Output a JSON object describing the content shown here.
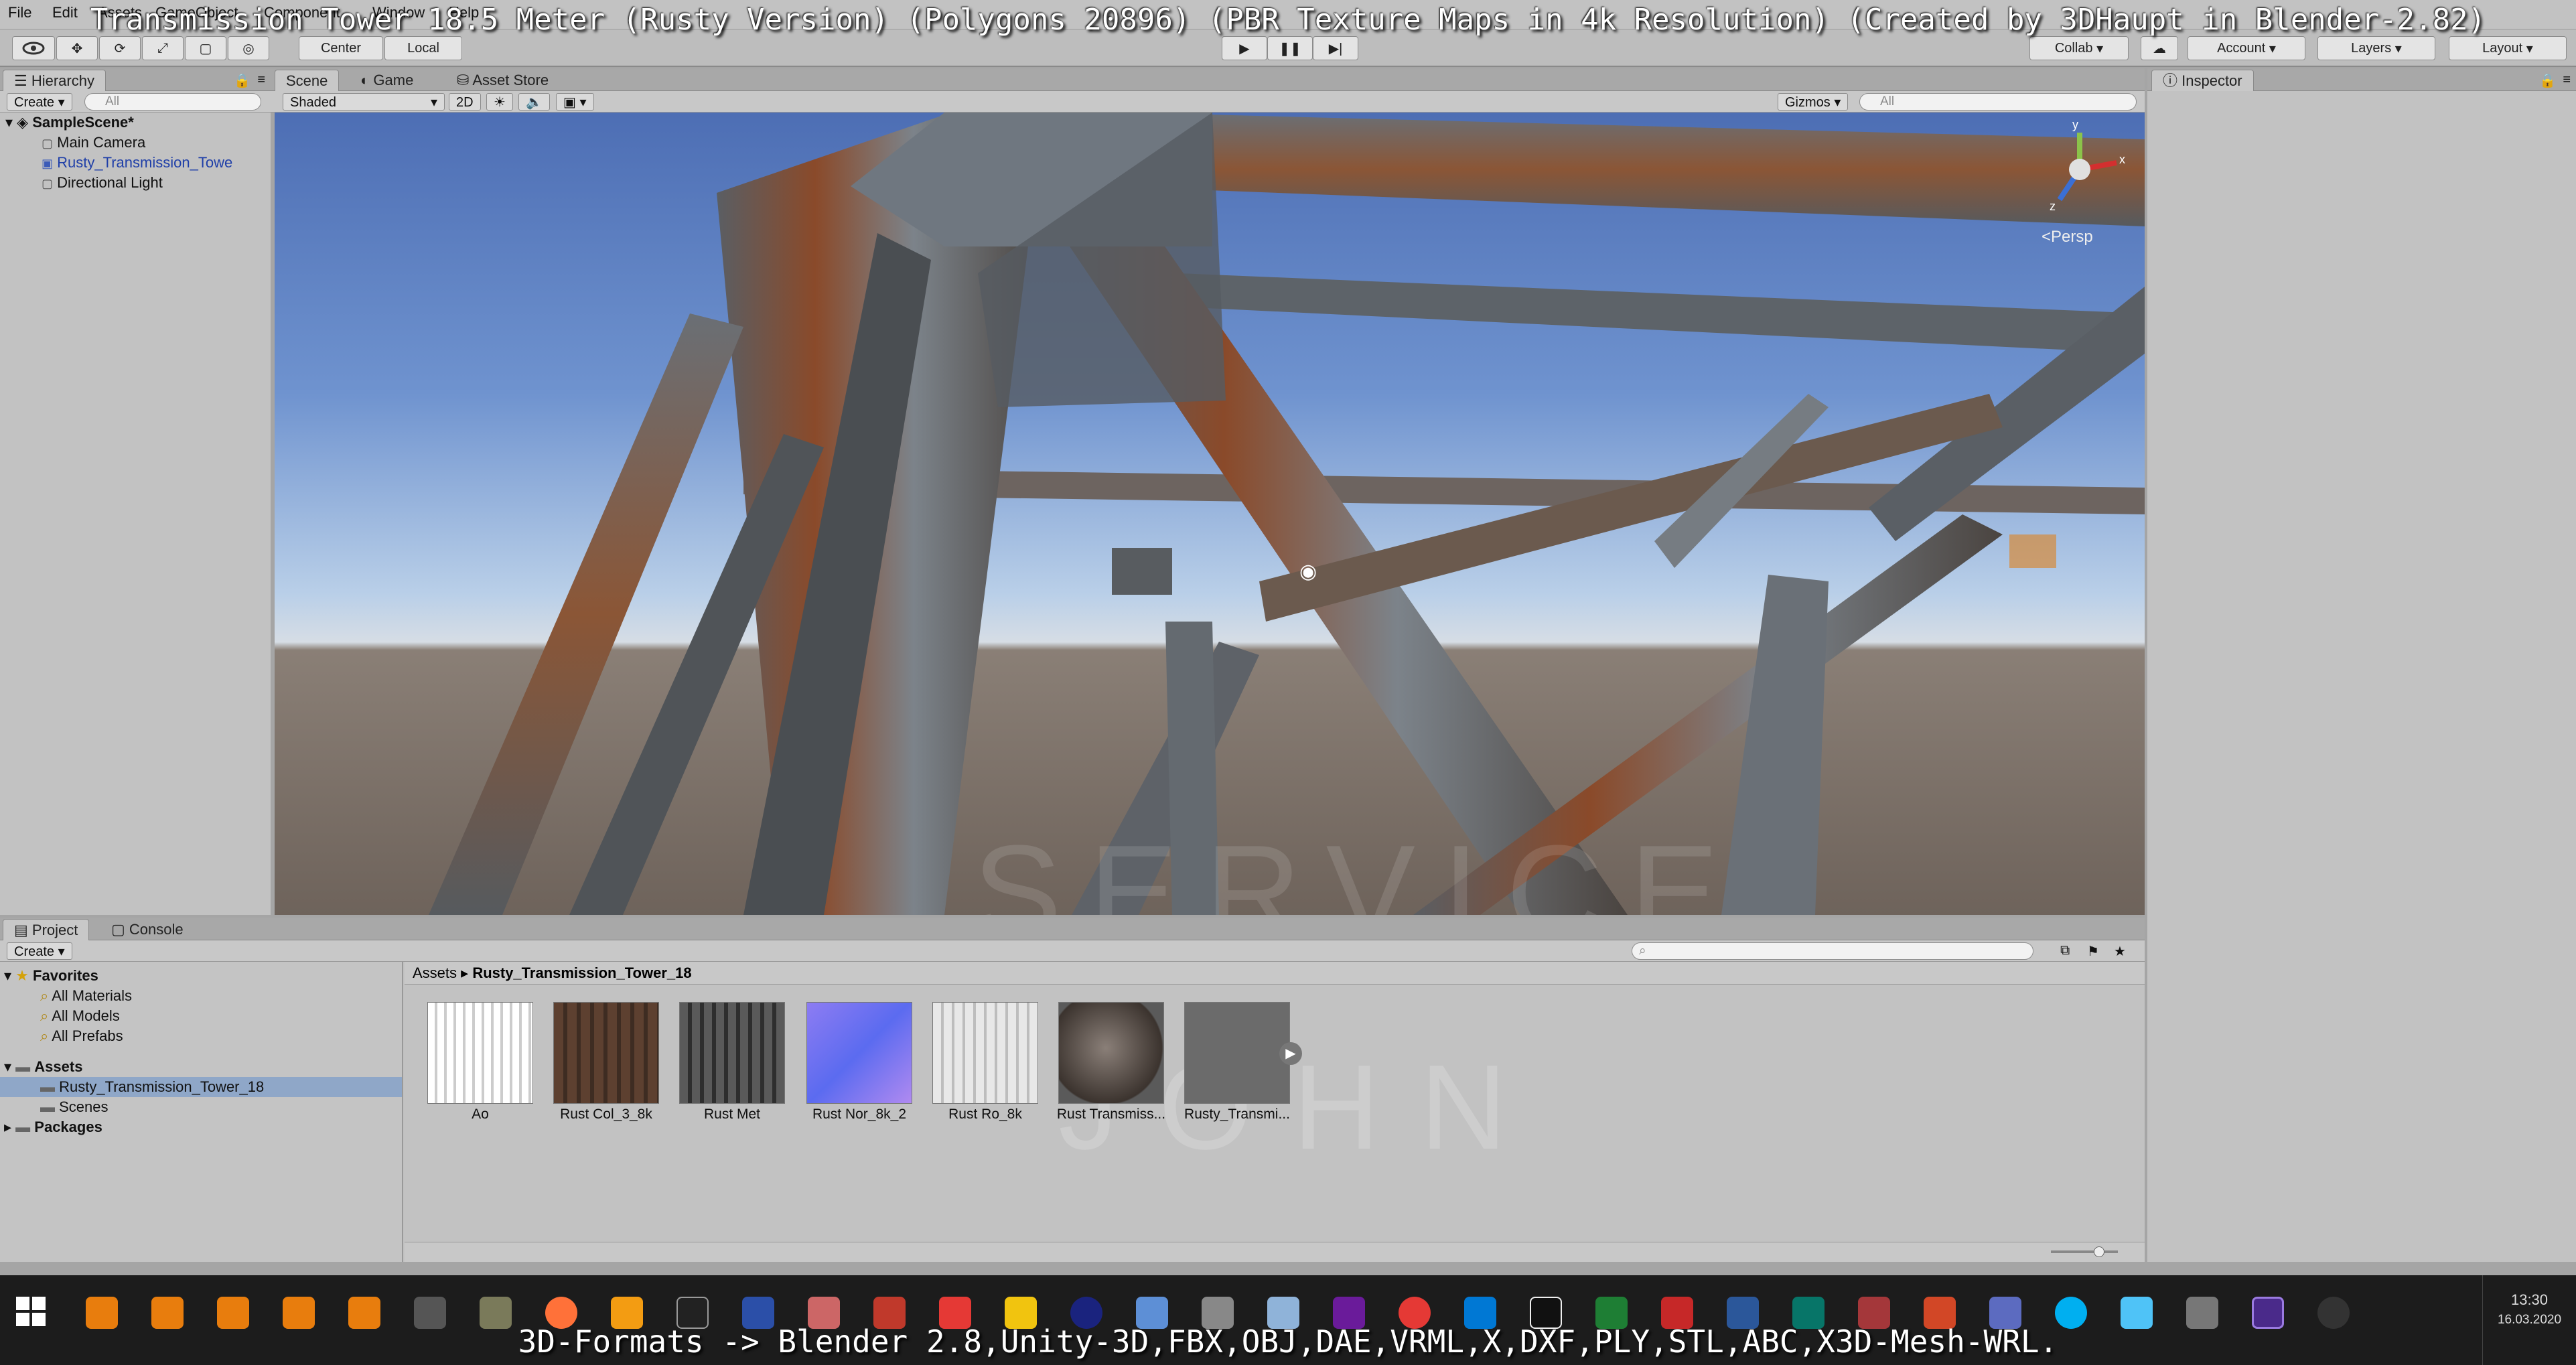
{
  "overlay": {
    "title": "Transmission Tower 18.5 Meter (Rusty Version) (Polygons 20896) (PBR Texture Maps in 4k Resolution) (Created by 3DHaupt in Blender-2.82)",
    "caption": "3D-Formats -> Blender 2.8,Unity-3D,FBX,OBJ,DAE,VRML,X,DXF,PLY,STL,ABC,X3D-Mesh-WRL."
  },
  "menu": [
    "File",
    "Edit",
    "Assets",
    "GameObject",
    "Component",
    "Window",
    "Help"
  ],
  "toolbar": {
    "pivot": "Center",
    "space": "Local",
    "collab": "Collab",
    "account": "Account",
    "layers": "Layers",
    "layout": "Layout"
  },
  "hierarchy": {
    "tab": "Hierarchy",
    "create": "Create",
    "search_placeholder": "All",
    "scene": "SampleScene*",
    "items": [
      "Main Camera",
      "Rusty_Transmission_Towe",
      "Directional Light"
    ]
  },
  "scene": {
    "tabs": [
      "Scene",
      "Game",
      "Asset Store"
    ],
    "shading": "Shaded",
    "mode_2d": "2D",
    "gizmos": "Gizmos",
    "search_placeholder": "All",
    "projection": "Persp",
    "gizmo_axes": [
      "y",
      "x",
      "z"
    ]
  },
  "inspector": {
    "tab": "Inspector"
  },
  "project": {
    "tabs": [
      "Project",
      "Console"
    ],
    "create": "Create",
    "favorites": {
      "label": "Favorites",
      "items": [
        "All Materials",
        "All Models",
        "All Prefabs"
      ]
    },
    "assets": {
      "label": "Assets",
      "items": [
        "Rusty_Transmission_Tower_18",
        "Scenes"
      ]
    },
    "packages": "Packages",
    "breadcrumb": [
      "Assets",
      "Rusty_Transmission_Tower_18"
    ],
    "files": [
      "Ao",
      "Rust Col_3_8k",
      "Rust Met",
      "Rust Nor_8k_2",
      "Rust Ro_8k",
      "Rust Transmiss...",
      "Rusty_Transmi..."
    ]
  },
  "watermark": {
    "line1": "SERVICE",
    "line2": "JOHN"
  },
  "clock": {
    "time": "13:30",
    "date": "16.03.2020"
  },
  "colors": {
    "selection": "#8fa7c8",
    "sky_top": "#4d6eb4",
    "rust": "#8a4a2a",
    "steel": "#6f7780"
  }
}
